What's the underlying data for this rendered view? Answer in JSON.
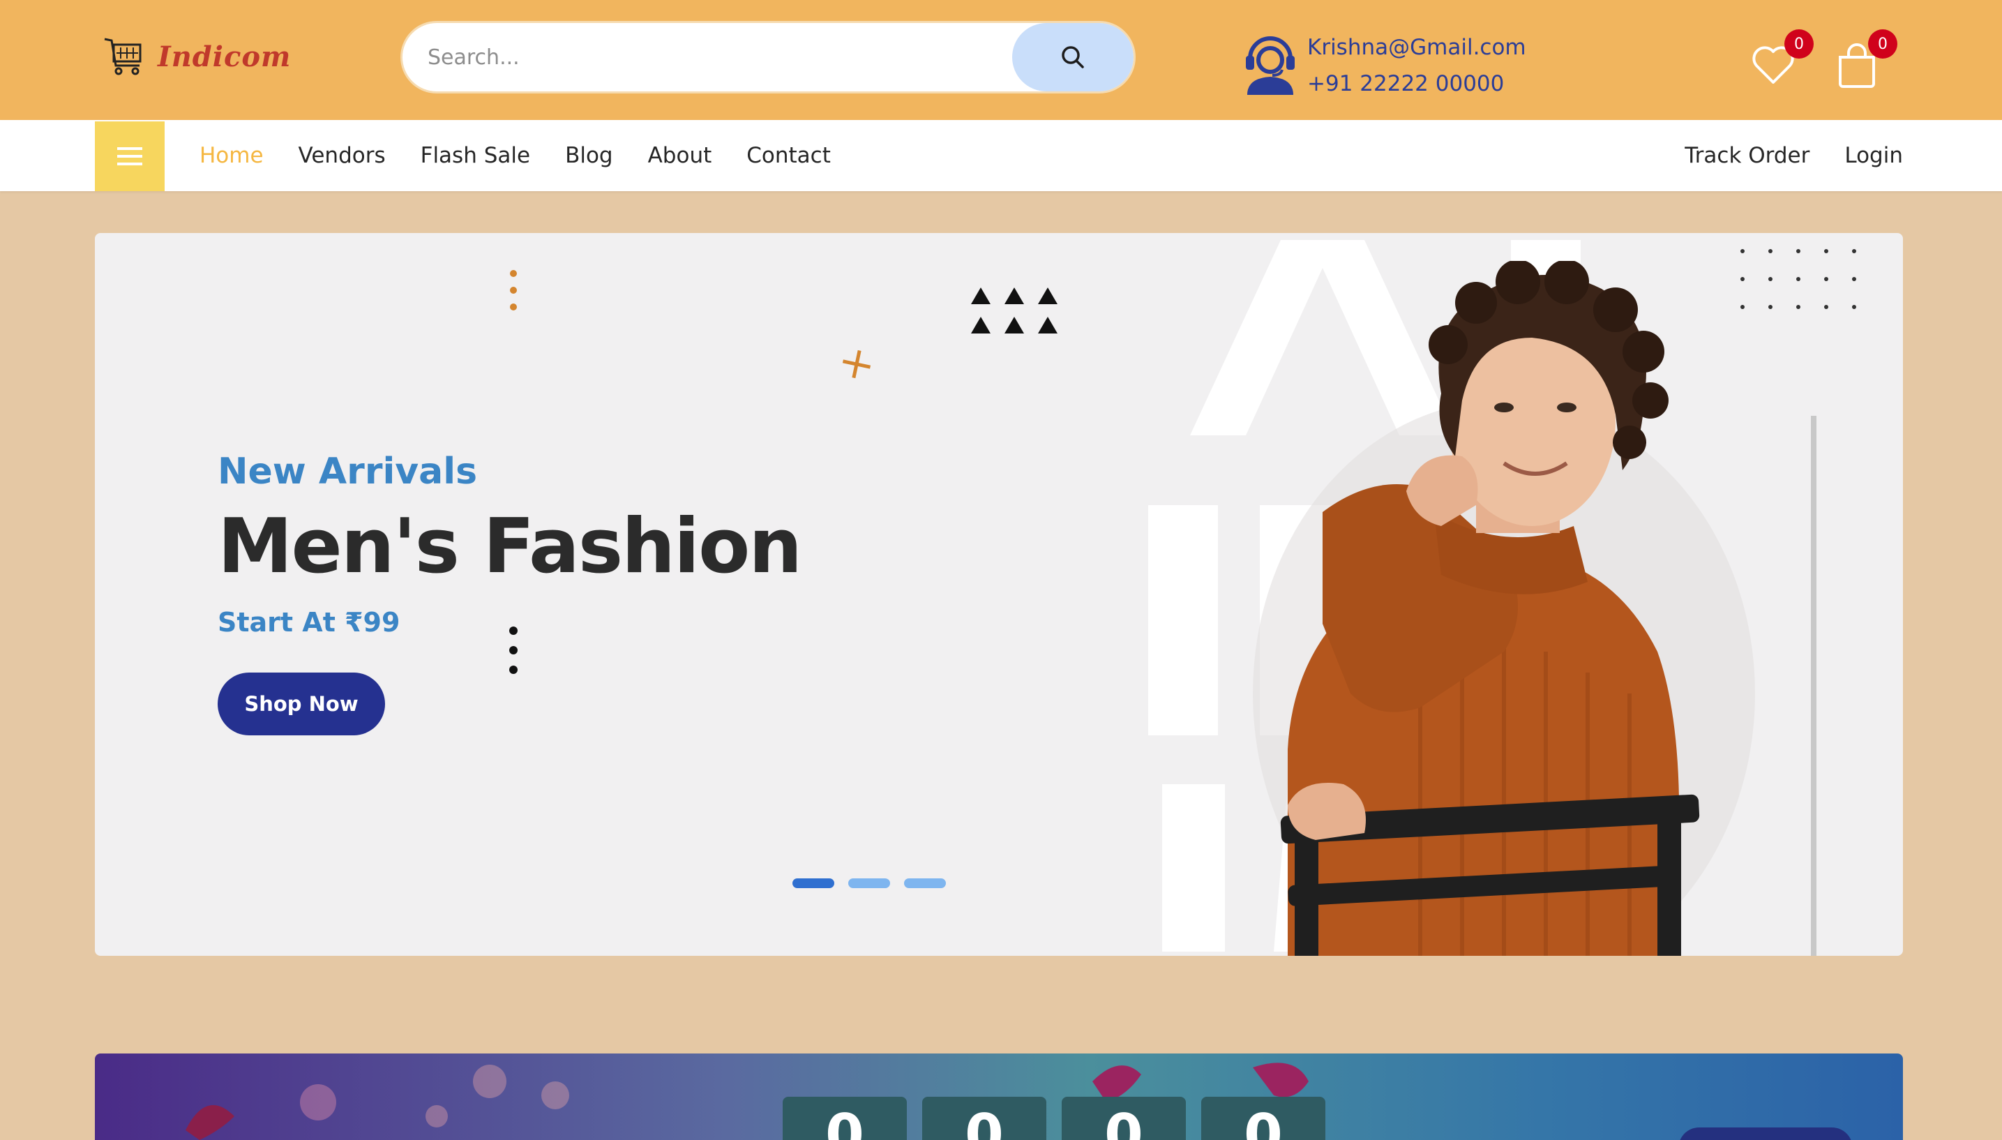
{
  "brand": {
    "name": "Indicom"
  },
  "search": {
    "placeholder": "Search..."
  },
  "contact": {
    "email": "Krishna@Gmail.com",
    "phone": "+91 22222 00000"
  },
  "wishlist": {
    "count": "0"
  },
  "cart": {
    "count": "0"
  },
  "nav": {
    "items": [
      "Home",
      "Vendors",
      "Flash Sale",
      "Blog",
      "About",
      "Contact"
    ],
    "active": "Home",
    "right": [
      "Track Order",
      "Login"
    ]
  },
  "hero": {
    "eyebrow": "New Arrivals",
    "title": "Men's Fashion",
    "subtitle": "Start At ₹99",
    "cta": "Shop Now",
    "slides": 3,
    "active_slide": 1
  },
  "promo": {
    "countdown": [
      "0",
      "0",
      "0",
      "0"
    ]
  },
  "colors": {
    "topbar": "#f1b55e",
    "page_bg": "#e5c8a4",
    "accent_blue": "#3b85c5",
    "button_navy": "#253190",
    "active_nav": "#f5b741",
    "badge_red": "#d0021b"
  },
  "icons": [
    "cart-logo-icon",
    "search-icon",
    "support-agent-icon",
    "heart-icon",
    "shopping-bag-icon",
    "hamburger-menu-icon"
  ]
}
